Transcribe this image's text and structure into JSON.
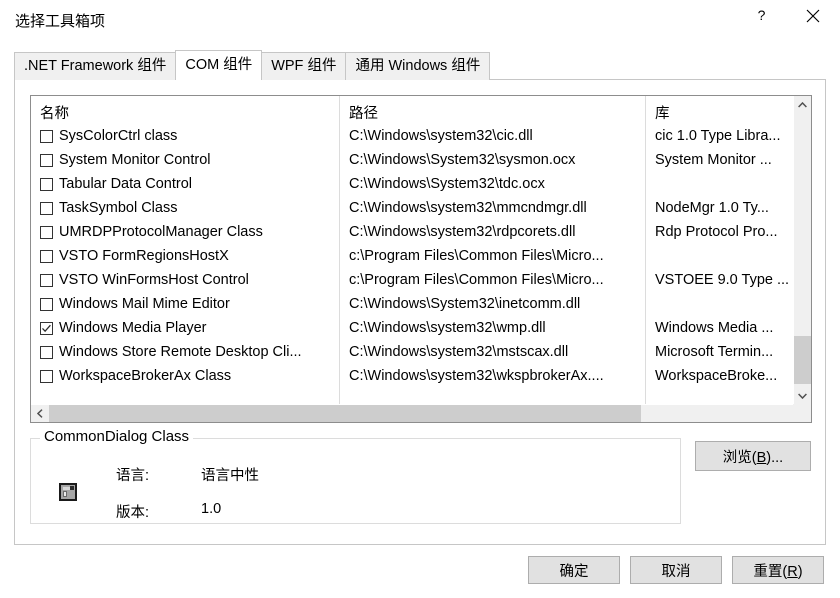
{
  "window": {
    "title": "选择工具箱项",
    "help_icon": "question-mark-icon",
    "close_icon": "close-icon"
  },
  "tabs": [
    {
      "label": ".NET Framework 组件",
      "selected": false
    },
    {
      "label": "COM 组件",
      "selected": true
    },
    {
      "label": "WPF 组件",
      "selected": false
    },
    {
      "label": "通用 Windows 组件",
      "selected": false
    }
  ],
  "list": {
    "columns": [
      "名称",
      "路径",
      "库"
    ],
    "rows": [
      {
        "checked": false,
        "name": "SysColorCtrl class",
        "path": "C:\\Windows\\system32\\cic.dll",
        "library": "cic 1.0 Type Libra..."
      },
      {
        "checked": false,
        "name": "System Monitor Control",
        "path": "C:\\Windows\\System32\\sysmon.ocx",
        "library": "System Monitor ..."
      },
      {
        "checked": false,
        "name": "Tabular Data Control",
        "path": "C:\\Windows\\System32\\tdc.ocx",
        "library": ""
      },
      {
        "checked": false,
        "name": "TaskSymbol Class",
        "path": "C:\\Windows\\system32\\mmcndmgr.dll",
        "library": "NodeMgr 1.0 Ty..."
      },
      {
        "checked": false,
        "name": "UMRDPProtocolManager  Class",
        "path": "C:\\Windows\\system32\\rdpcorets.dll",
        "library": "Rdp Protocol Pro..."
      },
      {
        "checked": false,
        "name": "VSTO FormRegionsHostX",
        "path": "c:\\Program Files\\Common Files\\Micro...",
        "library": ""
      },
      {
        "checked": false,
        "name": "VSTO WinFormsHost Control",
        "path": "c:\\Program Files\\Common Files\\Micro...",
        "library": "VSTOEE 9.0 Type ..."
      },
      {
        "checked": false,
        "name": "Windows Mail Mime Editor",
        "path": "C:\\Windows\\System32\\inetcomm.dll",
        "library": ""
      },
      {
        "checked": true,
        "name": "Windows Media Player",
        "path": "C:\\Windows\\system32\\wmp.dll",
        "library": "Windows Media ..."
      },
      {
        "checked": false,
        "name": "Windows Store Remote Desktop Cli...",
        "path": "C:\\Windows\\system32\\mstscax.dll",
        "library": "Microsoft Termin..."
      },
      {
        "checked": false,
        "name": "WorkspaceBrokerAx Class",
        "path": "C:\\Windows\\system32\\wkspbrokerAx....",
        "library": "WorkspaceBroke..."
      }
    ],
    "scrollbars": {
      "vertical_up_icon": "chevron-up-icon",
      "vertical_down_icon": "chevron-down-icon",
      "horizontal_left_icon": "chevron-left-icon",
      "horizontal_right_icon": "chevron-right-icon"
    }
  },
  "details": {
    "title": "CommonDialog Class",
    "icon": "com-component-icon",
    "language_label": "语言:",
    "language_value": "语言中性",
    "version_label": "版本:",
    "version_value": "1.0"
  },
  "buttons": {
    "browse": "浏览(B)...",
    "browse_accel": "B",
    "ok": "确定",
    "cancel": "取消",
    "reset": "重置(R)",
    "reset_accel": "R"
  }
}
